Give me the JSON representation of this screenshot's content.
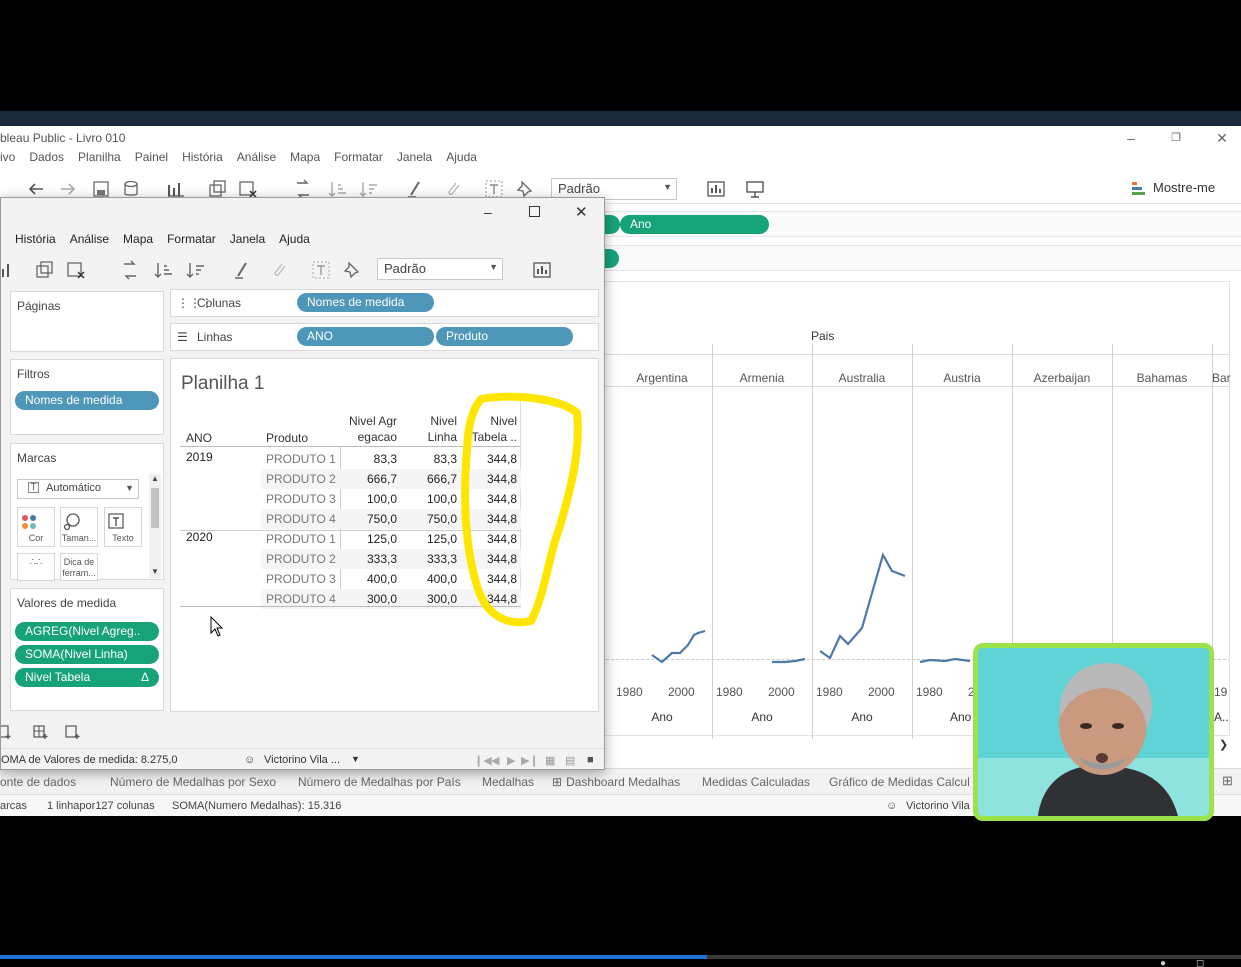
{
  "main_window": {
    "title": "bleau Public - Livro 010",
    "menu": [
      "ivo",
      "Dados",
      "Planilha",
      "Painel",
      "História",
      "Análise",
      "Mapa",
      "Formatar",
      "Janela",
      "Ajuda"
    ],
    "toolbar": {
      "fit_dropdown": "Padrão",
      "show_me": "Mostre-me"
    },
    "columns_pill": "Ano",
    "view": {
      "header": "Pais",
      "countries": [
        "Argentina",
        "Armenia",
        "Australia",
        "Austria",
        "Azerbaijan",
        "Bahamas",
        "Bar"
      ],
      "axis_ticks": [
        "1980",
        "2000",
        "1980",
        "2000",
        "1980",
        "2000",
        "1980",
        "2",
        "19"
      ],
      "axis_labels": [
        "Ano",
        "Ano",
        "Ano",
        "Ano",
        "A.."
      ]
    },
    "sheet_tabs": [
      "onte de dados",
      "Número de Medalhas por Sexo",
      "Número de Medalhas por País",
      "Medalhas",
      "Dashboard Medalhas",
      "Medidas Calculadas",
      "Gráfico de Medidas Calcul"
    ],
    "status": {
      "marks": "arcas",
      "rows_cols": "1 linhapor127 colunas",
      "sum": "SOMA(Numero Medalhas): 15.316",
      "user": "Victorino Vila"
    }
  },
  "float_window": {
    "menu": [
      "História",
      "Análise",
      "Mapa",
      "Formatar",
      "Janela",
      "Ajuda"
    ],
    "fit_dropdown": "Padrão",
    "cards": {
      "pages": "Páginas",
      "filters": "Filtros",
      "filter_pill": "Nomes de medida",
      "marks": "Marcas",
      "mark_type": "Automático",
      "mark_tiles": [
        "Cor",
        "Taman...",
        "Texto",
        "Dica de ferram..."
      ],
      "measure_values": "Valores de medida",
      "measure_pills": [
        "AGREG(Nivel Agreg..",
        "SOMA(Nivel Linha)",
        "Nivel Tabela"
      ],
      "delta": "Δ"
    },
    "shelves": {
      "columns_label": "Colunas",
      "columns_pill": "Nomes de medida",
      "rows_label": "Linhas",
      "rows_pills": [
        "ANO",
        "Produto"
      ]
    },
    "sheet_title": "Planilha 1",
    "table": {
      "headers": {
        "year": "ANO",
        "product": "Produto",
        "m1": [
          "Nivel Agr",
          "egacao"
        ],
        "m2": [
          "Nivel",
          "Linha"
        ],
        "m3": [
          "Nivel",
          "Tabela .."
        ]
      },
      "groups": [
        {
          "year": "2019",
          "rows": [
            {
              "product": "PRODUTO 1",
              "agr": "83,3",
              "linha": "83,3",
              "tabela": "344,8"
            },
            {
              "product": "PRODUTO 2",
              "agr": "666,7",
              "linha": "666,7",
              "tabela": "344,8"
            },
            {
              "product": "PRODUTO 3",
              "agr": "100,0",
              "linha": "100,0",
              "tabela": "344,8"
            },
            {
              "product": "PRODUTO 4",
              "agr": "750,0",
              "linha": "750,0",
              "tabela": "344,8"
            }
          ]
        },
        {
          "year": "2020",
          "rows": [
            {
              "product": "PRODUTO 1",
              "agr": "125,0",
              "linha": "125,0",
              "tabela": "344,8"
            },
            {
              "product": "PRODUTO 2",
              "agr": "333,3",
              "linha": "333,3",
              "tabela": "344,8"
            },
            {
              "product": "PRODUTO 3",
              "agr": "400,0",
              "linha": "400,0",
              "tabela": "344,8"
            },
            {
              "product": "PRODUTO 4",
              "agr": "300,0",
              "linha": "300,0",
              "tabela": "344,8"
            }
          ]
        }
      ]
    },
    "status": {
      "sum": "OMA de Valores de medida: 8.275,0",
      "user": "Victorino Vila ..."
    }
  },
  "icons": [
    "undo-icon",
    "redo-icon",
    "save-icon",
    "new-datasource-icon",
    "new-sheet-icon",
    "duplicate-icon",
    "clear-icon",
    "swap-icon",
    "sort-asc-icon",
    "sort-desc-icon",
    "highlight-icon",
    "pin-icon",
    "chart-icon",
    "presentation-icon",
    "mostre-me-icon"
  ],
  "colors": {
    "green_pill": "#17a37a",
    "blue_pill": "#4e97b9",
    "line": "#4e79a7",
    "highlight_marker": "#ffe600",
    "webcam_border": "#9be24b"
  },
  "video": {
    "progress": 0.57
  }
}
